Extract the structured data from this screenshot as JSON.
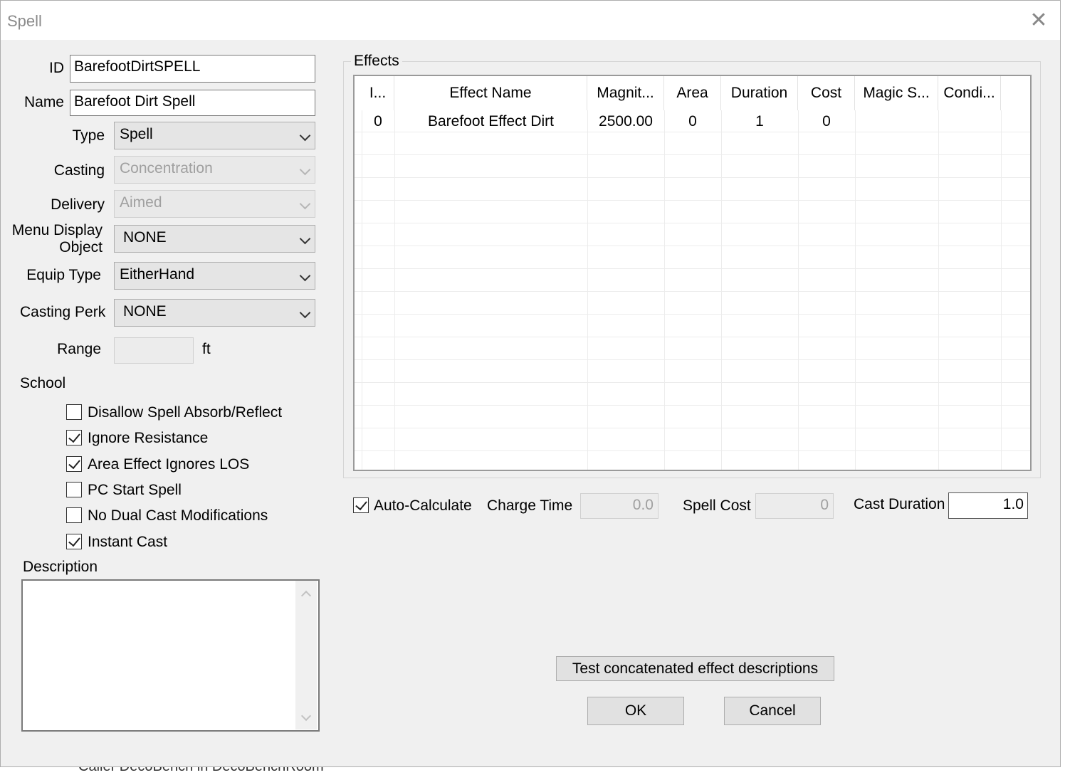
{
  "window": {
    "title": "Spell",
    "close_label": "✕"
  },
  "form": {
    "id_label": "ID",
    "id_value": "BarefootDirtSPELL",
    "name_label": "Name",
    "name_value": "Barefoot Dirt Spell",
    "type_label": "Type",
    "type_value": "Spell",
    "casting_label": "Casting",
    "casting_value": "Concentration",
    "delivery_label": "Delivery",
    "delivery_value": "Aimed",
    "menu_display_label_1": "Menu Display",
    "menu_display_label_2": "Object",
    "menu_display_value": "NONE",
    "equip_type_label": "Equip Type",
    "equip_type_value": "EitherHand",
    "casting_perk_label": "Casting Perk",
    "casting_perk_value": "NONE",
    "range_label": "Range",
    "range_value": "",
    "range_unit": "ft",
    "school_label": "School"
  },
  "flags": [
    {
      "label": "Disallow Spell Absorb/Reflect",
      "checked": false
    },
    {
      "label": "Ignore Resistance",
      "checked": true
    },
    {
      "label": "Area Effect Ignores LOS",
      "checked": true
    },
    {
      "label": "PC Start Spell",
      "checked": false
    },
    {
      "label": "No Dual Cast Modifications",
      "checked": false
    },
    {
      "label": "Instant Cast",
      "checked": true
    }
  ],
  "description": {
    "label": "Description",
    "value": ""
  },
  "effects": {
    "title": "Effects",
    "columns": [
      "I...",
      "Effect Name",
      "Magnit...",
      "Area",
      "Duration",
      "Cost",
      "Magic S...",
      "Condi..."
    ],
    "rows": [
      [
        "0",
        "Barefoot Effect Dirt",
        "2500.00",
        "0",
        "1",
        "0",
        "",
        ""
      ]
    ]
  },
  "calc": {
    "auto_label": "Auto-Calculate",
    "auto_checked": true,
    "charge_time_label": "Charge Time",
    "charge_time_value": "0.0",
    "spell_cost_label": "Spell Cost",
    "spell_cost_value": "0",
    "cast_duration_label": "Cast Duration",
    "cast_duration_value": "1.0"
  },
  "buttons": {
    "test_label": "Test concatenated effect descriptions",
    "ok_label": "OK",
    "cancel_label": "Cancel"
  },
  "background_window": {
    "row_text": "Caller DecoBench in DecoBenchRoom"
  }
}
